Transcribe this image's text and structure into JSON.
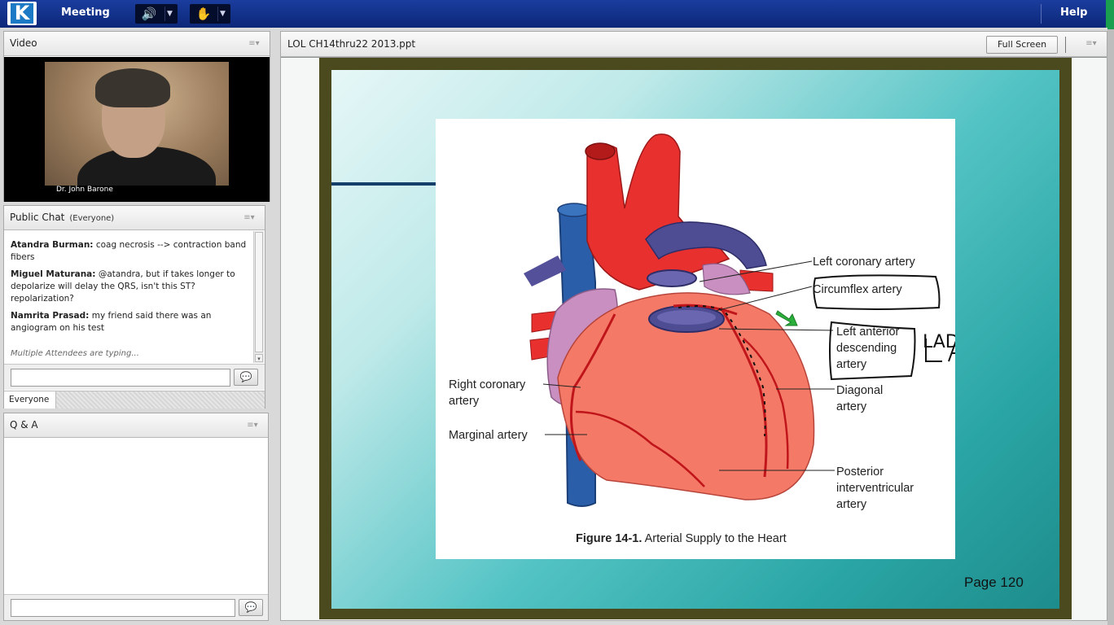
{
  "topbar": {
    "logo_letter": "K",
    "menu_meeting": "Meeting",
    "menu_help": "Help",
    "audio_icon": "speaker-icon",
    "raise_icon": "raise-hand-icon",
    "accent_color": "#1a9e4f"
  },
  "video": {
    "title": "Video",
    "presenter_name": "Dr. John Barone"
  },
  "chat": {
    "title": "Public Chat",
    "audience": "(Everyone)",
    "messages": [
      {
        "author": "Atandra Burman:",
        "text": "coag necrosis --> contraction band fibers"
      },
      {
        "author": "Miguel Maturana:",
        "text": "@atandra, but if takes longer to depolarize will delay the QRS, isn't this ST? repolarization?"
      },
      {
        "author": "Namrita Prasad:",
        "text": "my friend said there was an angiogram on his test"
      }
    ],
    "typing_status": "Multiple Attendees are typing...",
    "input_value": "",
    "tab_everyone": "Everyone"
  },
  "qa": {
    "title": "Q & A",
    "input_value": ""
  },
  "share": {
    "title": "LOL CH14thru22 2013.ppt",
    "fullscreen_label": "Full Screen",
    "slide": {
      "labels": {
        "left_coronary": "Left coronary artery",
        "circumflex": "Circumflex artery",
        "lad": "Left anterior descending artery",
        "right_coronary": "Right coronary artery",
        "diagonal": "Diagonal artery",
        "marginal": "Marginal artery",
        "posterior": "Posterior interventricular artery"
      },
      "handwritten_annotation": "LAD",
      "caption_bold": "Figure 14-1.",
      "caption_text": " Arterial Supply to the Heart",
      "page_number": "Page 120"
    }
  }
}
